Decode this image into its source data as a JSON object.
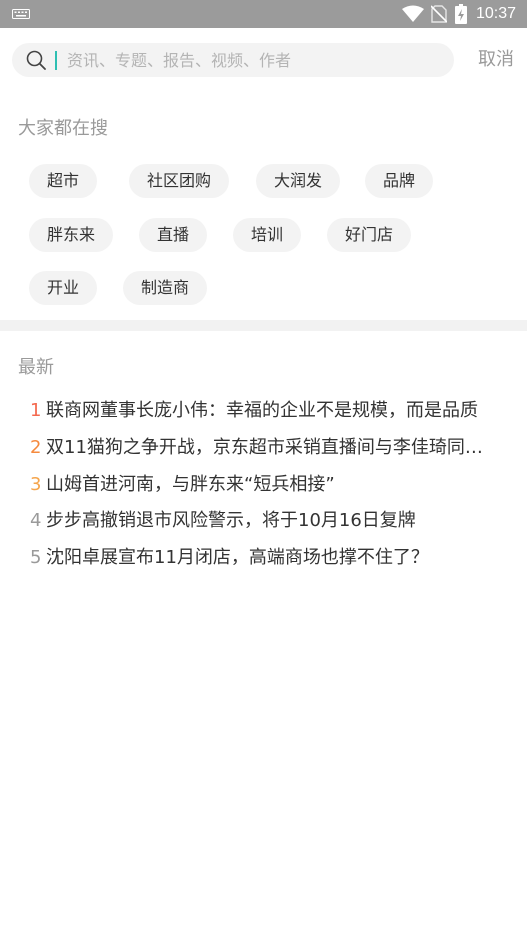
{
  "status_bar": {
    "time": "10:37",
    "icons": [
      "keyboard-icon",
      "wifi-icon",
      "no-sim-icon",
      "battery-charging-icon"
    ]
  },
  "search": {
    "placeholder": "资讯、专题、报告、视频、作者",
    "cancel_label": "取消"
  },
  "hot_search": {
    "title": "大家都在搜",
    "tags": [
      "超市",
      "社区团购",
      "大润发",
      "品牌",
      "胖东来",
      "直播",
      "培训",
      "好门店",
      "开业",
      "制造商"
    ]
  },
  "latest": {
    "title": "最新",
    "items": [
      {
        "rank": "1",
        "title": "联商网董事长庞小伟：幸福的企业不是规模，而是品质",
        "rank_color": "#f4694f"
      },
      {
        "rank": "2",
        "title": "双11猫狗之争开战，京东超市采销直播间与李佳琦同…",
        "rank_color": "#f58a3e"
      },
      {
        "rank": "3",
        "title": "山姆首进河南，与胖东来“短兵相接”",
        "rank_color": "#f5a54c"
      },
      {
        "rank": "4",
        "title": "步步高撤销退市风险警示，将于10月16日复牌",
        "rank_color": "#9a9a9a"
      },
      {
        "rank": "5",
        "title": "沈阳卓展宣布11月闭店，高端商场也撑不住了？",
        "rank_color": "#9a9a9a"
      }
    ]
  }
}
